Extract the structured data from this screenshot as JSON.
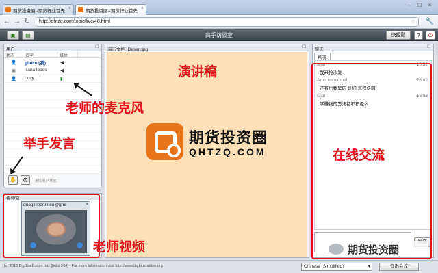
{
  "browser": {
    "tabs": [
      {
        "label": "期货投资圈--期货行业首先"
      },
      {
        "label": "期货投资圈--期货行业首先"
      }
    ],
    "url": "http://qhtzq.com/topic/live/40.html",
    "controls": {
      "minimize": "–",
      "maximize": "□",
      "close": "×"
    }
  },
  "toolbar": {
    "room_title": "高手访谈室",
    "shortcut_label": "快捷键",
    "help_label": "?"
  },
  "users_panel": {
    "title": "用户",
    "columns": [
      "状态",
      "名字",
      "媒体"
    ],
    "users": [
      {
        "name": "giaice (我)"
      },
      {
        "name": "iliana lopes"
      },
      {
        "name": "Lucy"
      }
    ],
    "clear_status_label": "清除用户状态"
  },
  "video_panel": {
    "title": "视频窗",
    "video_user": "quaglietiennrico@gmi"
  },
  "presentation": {
    "title": "演示文档: Desert.jpg",
    "logo_cn": "期货投资圈",
    "logo_en": "QHTZQ.COM"
  },
  "chat": {
    "title": "聊天",
    "tab_label": "所有",
    "messages": [
      {
        "sender": "fajar",
        "time": "15:52",
        "text": "我来抢沙发"
      },
      {
        "sender": "Arun Immanuel",
        "time": "16:02",
        "text": "还有比我早的 哥们 真积极啊"
      },
      {
        "sender": "fajar",
        "time": "16:03",
        "text": "学赚钱的方法都不积极么"
      }
    ],
    "send_label": "发送"
  },
  "statusbar": {
    "copyright": "(c) 2013 BigBlueButton Inc. [build 264] - For more information visit http://www.bigbluebutton.org",
    "language": "Chinese (Simplified)",
    "logout_label": "登出会议"
  },
  "annotations": {
    "slides": "演讲稿",
    "teacher_mic": "老师的麦克风",
    "raise_hand": "举手发言",
    "online_chat": "在线交流",
    "teacher_video": "老师视频",
    "color": "#e0141b"
  },
  "watermark": "期货投资圈"
}
